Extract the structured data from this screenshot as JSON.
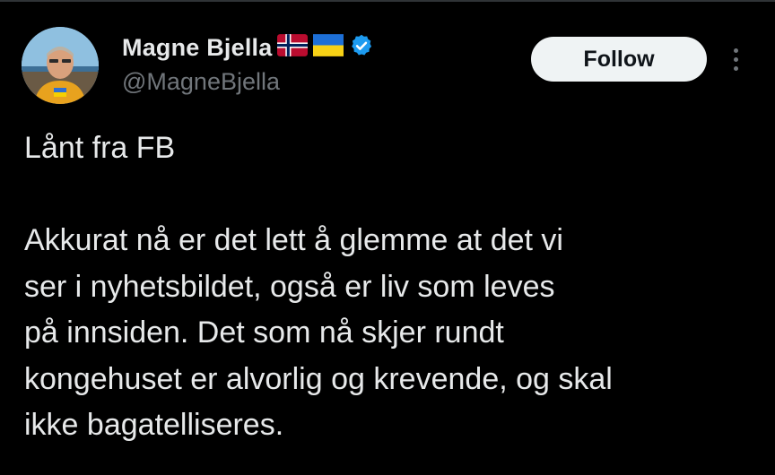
{
  "tweet": {
    "author": {
      "display_name": "Magne Bjella",
      "handle": "@MagneBjella",
      "badges": [
        "norway-flag-icon",
        "ukraine-flag-icon",
        "verified-badge-icon"
      ]
    },
    "follow_label": "Follow",
    "more_icon": "more-vertical-icon",
    "text_lines": [
      "Lånt fra FB",
      "",
      "Akkurat nå er det lett å glemme at det vi",
      "ser i nyhetsbildet, også er liv som leves",
      "på innsiden. Det som nå skjer rundt",
      "kongehuset er alvorlig og krevende, og skal",
      "ikke bagatelliseres."
    ]
  },
  "colors": {
    "background": "#000000",
    "text_primary": "#e7e9ea",
    "text_secondary": "#71767b",
    "verified_blue": "#1d9bf0",
    "follow_bg": "#eff3f4",
    "follow_text": "#0f1419"
  }
}
